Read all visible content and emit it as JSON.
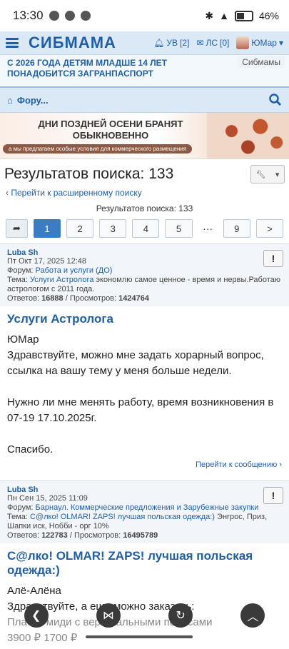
{
  "status": {
    "time": "13:30",
    "battery": "46%"
  },
  "nav": {
    "logo": "СИБМАМА",
    "ub_label": "УВ",
    "ub_count": "[2]",
    "ls_label": "ЛС",
    "ls_count": "[0]",
    "user": "ЮМар"
  },
  "announce": {
    "text": "С 2026 ГОДА ДЕТЯМ МЛАДШЕ 14 ЛЕТ ПОНАДОБИТСЯ ЗАГРАНПАСПОРТ",
    "tag": "Сибмамы"
  },
  "forumbar": {
    "label": "Фору..."
  },
  "banner": {
    "title": "ДНИ ПОЗДНЕЙ ОСЕНИ БРАНЯТ ОБЫКНОВЕННО",
    "subtitle": "а мы предлагаем особые условия для коммерческого размещения"
  },
  "results": {
    "title": "Результатов поиска: 133",
    "advanced": "Перейти к расширенному поиску",
    "count": "Результатов поиска: 133"
  },
  "pager": {
    "pages": [
      "1",
      "2",
      "3",
      "4",
      "5"
    ],
    "ellipsis": "···",
    "last": "9",
    "next": ">"
  },
  "posts": [
    {
      "author": "Luba Sh",
      "date": "Пт Окт 17, 2025 12:48",
      "forum_label": "Форум:",
      "forum": "Работа и услуги (ДО)",
      "topic_label": "Тема:",
      "topic": "Услуги Астролога",
      "topic_rest": "экономлю самое ценное - время и нервы.Работаю астрологом с 2011 года.",
      "replies_label": "Ответов:",
      "replies": "16888",
      "views_label": "/ Просмотров:",
      "views": "1424764",
      "heading": "Услуги Астролога",
      "body_lines": [
        "ЮМар",
        "Здравствуйте, можно мне задать хорарный вопрос, ссылка на вашу тему у меня больше недели.",
        "",
        "Нужно ли мне менять работу, время возникновения в 07-19 17.10.2025г.",
        "",
        "Спасибо."
      ],
      "goto": "Перейти к сообщению"
    },
    {
      "author": "Luba Sh",
      "date": "Пн Сен 15, 2025 11:09",
      "forum_label": "Форум:",
      "forum": "Барнаул. Коммерческие предложения и Зарубежные закупки",
      "topic_label": "Тема:",
      "topic": "С@лко! OLMAR! ZAPS! лучшая польская одежда:)",
      "topic_rest": "Энгрос, Приз, Шапки иск, Нобби - орг 10%",
      "replies_label": "Ответов:",
      "replies": "122783",
      "views_label": "/ Просмотров:",
      "views": "16495789",
      "heading": "С@лко! OLMAR! ZAPS! лучшая польская одежда:)",
      "body_lines": [
        "Алё-Алёна",
        "Здравствуйте, а еще можно заказать:",
        "Платье миди с вертикальными полосами",
        "3900 ₽ 1700 ₽"
      ]
    }
  ]
}
